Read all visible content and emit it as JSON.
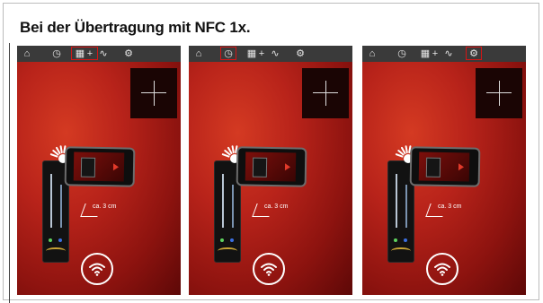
{
  "title": "Bei der Übertragung  mit NFC 1x.",
  "panels": [
    {
      "highlight": "tab-group-calendar-plus"
    },
    {
      "highlight": "clock"
    },
    {
      "highlight": "settings"
    }
  ],
  "topbar_icons": [
    "home-icon",
    "clock-icon",
    "calendar-icon",
    "plus-icon",
    "graph-icon",
    "settings-icon"
  ],
  "distance_label": "ca. 3 cm",
  "colors": {
    "accent": "#d21616",
    "panel_dark": "#5d0807",
    "panel_light": "#d43a22"
  }
}
